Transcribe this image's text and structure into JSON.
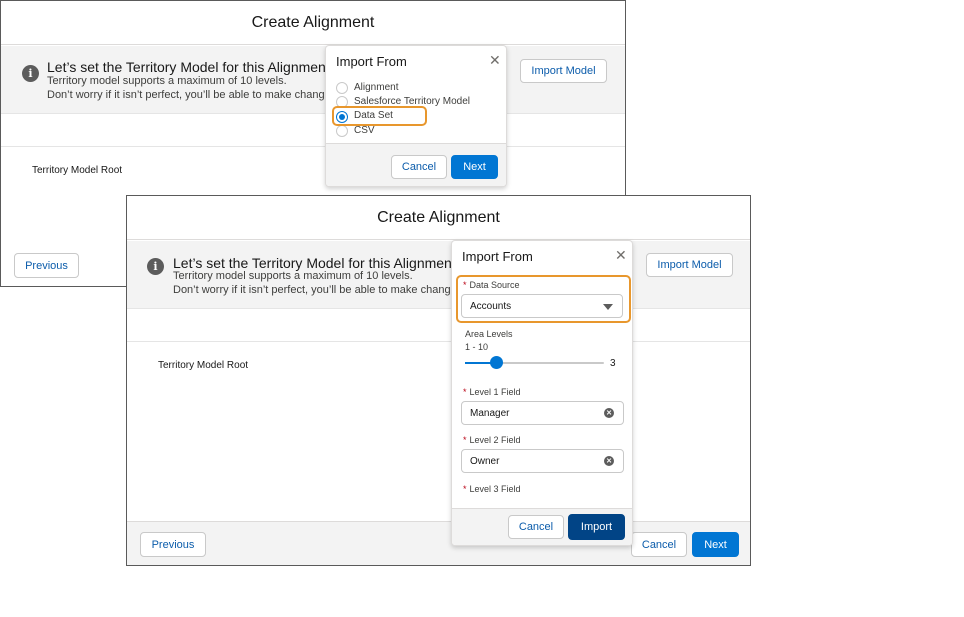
{
  "back_window": {
    "title": "Create Alignment",
    "banner": {
      "heading": "Let’s set the Territory Model for this Alignment",
      "line1": "Territory model supports a maximum of 10 levels.",
      "line2": "Don’t worry if it isn’t perfect, you’ll be able to make changes",
      "import_button": "Import Model"
    },
    "tree_root": "Territory Model Root",
    "previous_button": "Previous",
    "popover": {
      "title": "Import From",
      "close": "✕",
      "options": [
        "Alignment",
        "Salesforce Territory Model",
        "Data Set",
        "CSV"
      ],
      "selected": "Data Set",
      "cancel": "Cancel",
      "next": "Next"
    }
  },
  "front_window": {
    "title": "Create Alignment",
    "banner": {
      "heading": "Let’s set the Territory Model for this Alignment",
      "line1": "Territory model supports a maximum of 10 levels.",
      "line2": "Don’t worry if it isn’t perfect, you’ll be able to make changes",
      "import_button": "Import Model"
    },
    "tree_root": "Territory Model Root",
    "previous_button": "Previous",
    "cancel_button": "Cancel",
    "next_button": "Next",
    "popover": {
      "title": "Import From",
      "close": "✕",
      "data_source_label": "Data Source",
      "data_source_value": "Accounts",
      "area_levels_label": "Area Levels",
      "area_levels_range": "1 - 10",
      "area_levels_value": "3",
      "area_levels_fraction": 0.22,
      "level1_label": "Level 1 Field",
      "level1_value": "Manager",
      "level2_label": "Level 2 Field",
      "level2_value": "Owner",
      "level3_label": "Level 3 Field",
      "required_mark": "*",
      "cancel": "Cancel",
      "import": "Import"
    }
  },
  "colors": {
    "brand": "#0176d3",
    "brand_dark": "#014486",
    "highlight": "#e8972d",
    "banner_bg": "#f3f3f3"
  }
}
